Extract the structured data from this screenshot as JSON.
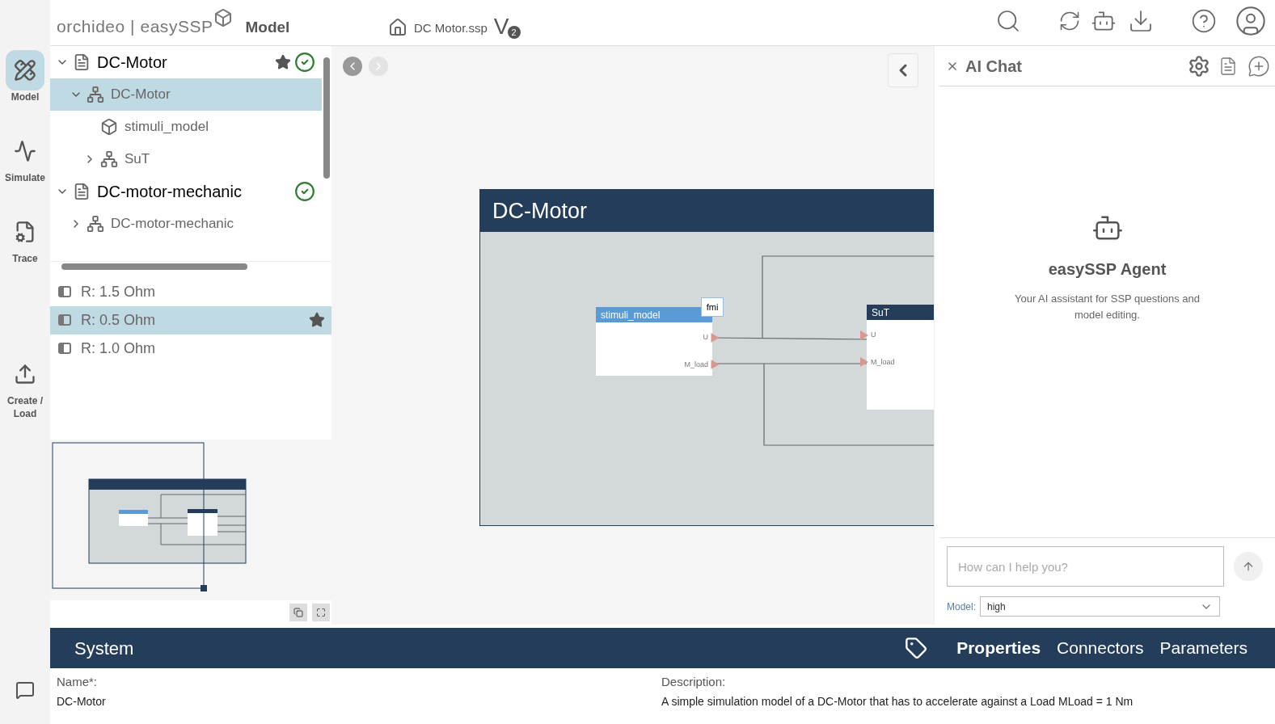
{
  "header": {
    "brand": "orchideo | easySSP",
    "section": "Model",
    "file": "DC Motor.ssp",
    "version_letter": "V",
    "version_number": "2"
  },
  "rail": [
    {
      "label": "Model",
      "kind": "model",
      "selected": true
    },
    {
      "label": "Simulate",
      "kind": "simulate",
      "selected": false
    },
    {
      "label": "Trace",
      "kind": "trace",
      "selected": false
    },
    {
      "label": "Create / Load",
      "kind": "create",
      "selected": false
    }
  ],
  "tree": [
    {
      "label": "DC-Motor",
      "kind": "ssp",
      "expanded": true,
      "starred": true,
      "valid": true,
      "selected": false,
      "children": [
        {
          "label": "DC-Motor",
          "kind": "system",
          "expanded": true,
          "selected": true,
          "children": [
            {
              "label": "stimuli_model",
              "kind": "fmu",
              "selected": false
            },
            {
              "label": "SuT",
              "kind": "system",
              "expanded": false,
              "selected": false
            }
          ]
        }
      ]
    },
    {
      "label": "DC-motor-mechanic",
      "kind": "ssp",
      "expanded": true,
      "starred": false,
      "valid": true,
      "selected": false,
      "children": [
        {
          "label": "DC-motor-mechanic",
          "kind": "system",
          "expanded": false,
          "selected": false
        }
      ]
    }
  ],
  "variants": [
    {
      "label": "R: 1.5 Ohm",
      "selected": false,
      "starred": false
    },
    {
      "label": "R: 0.5 Ohm",
      "selected": true,
      "starred": true
    },
    {
      "label": "R: 1.0 Ohm",
      "selected": false,
      "starred": false
    }
  ],
  "diagram": {
    "title": "DC-Motor",
    "components": [
      {
        "name": "stimuli_model",
        "kind": "fmu",
        "badge": "fmi",
        "ports": [
          "U",
          "M_load"
        ]
      },
      {
        "name": "SuT",
        "kind": "system",
        "ports": [
          "U",
          "M_load"
        ]
      }
    ]
  },
  "chat": {
    "title": "AI Chat",
    "agent_name": "easySSP Agent",
    "agent_description": "Your AI assistant for SSP questions and model editing.",
    "placeholder": "How can I help you?",
    "model_label": "Model:",
    "model_value": "high"
  },
  "properties": {
    "title": "System",
    "tabs": [
      {
        "label": "Properties",
        "selected": true
      },
      {
        "label": "Connectors",
        "selected": false
      },
      {
        "label": "Parameters",
        "selected": false
      }
    ],
    "fields": [
      {
        "label": "Name*:",
        "value": "DC-Motor"
      },
      {
        "label": "Description:",
        "value": "A simple simulation model of a DC-Motor that has to accelerate against a Load MLoad = 1 Nm"
      }
    ]
  }
}
